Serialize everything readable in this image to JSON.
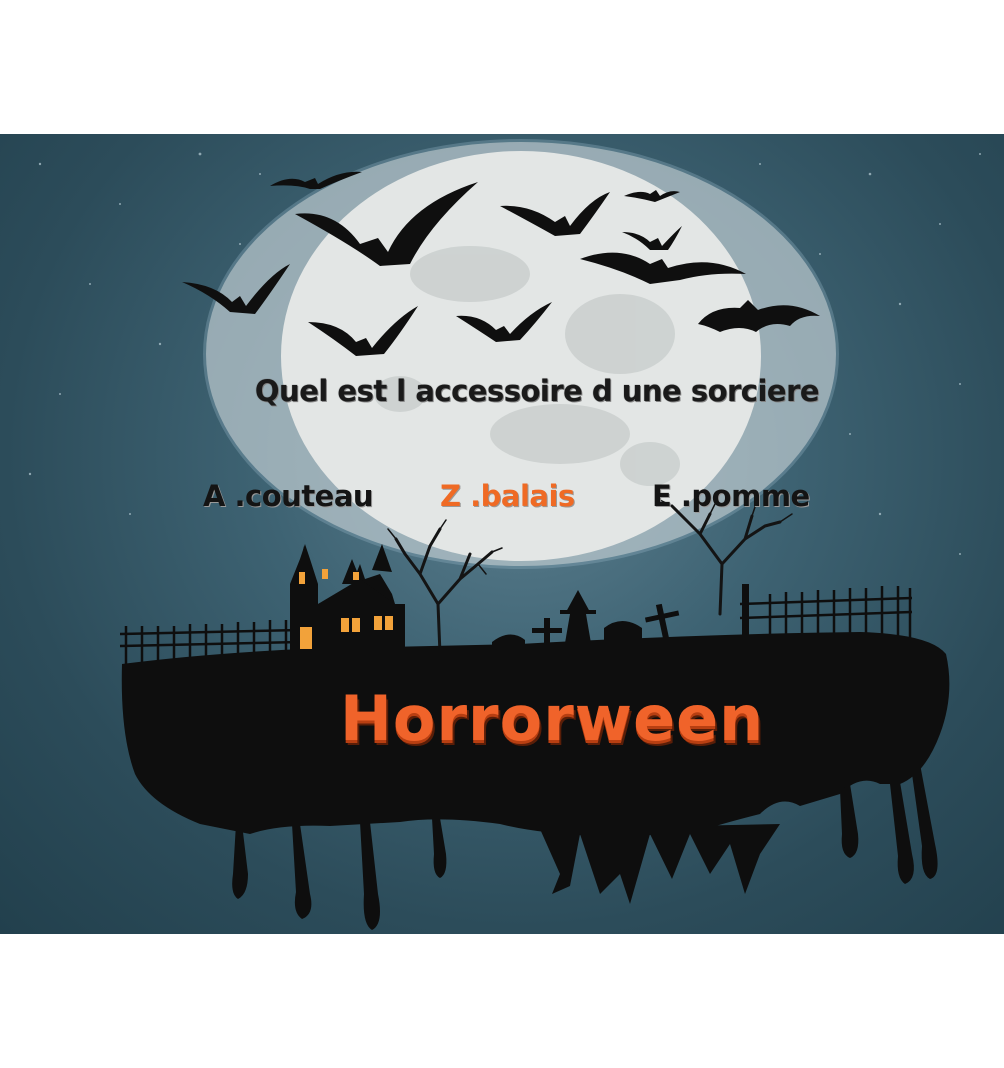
{
  "question": "Quel est l accessoire d une sorciere",
  "answers": [
    {
      "key": "A",
      "label": "A .couteau"
    },
    {
      "key": "Z",
      "label": "Z .balais"
    },
    {
      "key": "E",
      "label": "E .pomme"
    }
  ],
  "title": "Horrorween",
  "colors": {
    "accent": "#ef6a24",
    "text": "#141414",
    "sky": "#3e6373",
    "moon": "#e4e7e6",
    "silhouette": "#0e0e0e",
    "window": "#f2a23a"
  }
}
